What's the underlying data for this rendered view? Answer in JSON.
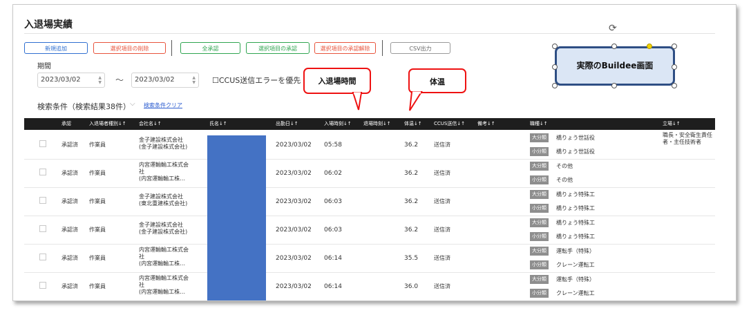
{
  "page": {
    "title": "入退場実績"
  },
  "toolbar": {
    "new_label": "新規追加",
    "delete_label": "選択項目の削除",
    "approve_all_label": "全承認",
    "approve_selected_label": "選択項目の承認",
    "unapprove_selected_label": "選択項目の承認解除",
    "csv_label": "CSV出力"
  },
  "filters": {
    "period_label": "期間",
    "date_from": "2023/03/02",
    "tilde": "～",
    "date_to": "2023/03/02",
    "ccus_priority_label": "☐CCUS送信エラーを優先",
    "search_conditions": "検索条件（検索結果38件）",
    "clear_label": "検索条件クリア"
  },
  "annotations": {
    "entry_time": "入退場時間",
    "temperature": "体温",
    "buildee": "実際のBuildee画面"
  },
  "colors": {
    "danger": "#e8533b",
    "success": "#2ea44f",
    "primary": "#2f6fd0",
    "table_header": "#1e1e1e",
    "name_mask": "#4472c4",
    "callout": "#ee1111"
  },
  "table": {
    "headers": {
      "approval": "承認",
      "entry_type": "入退場者種別↓↑",
      "company": "会社名↓↑",
      "name": "氏名↓↑",
      "work_date": "出勤日↓↑",
      "entry_time": "入場時刻↓↑",
      "exit_time": "退場時刻↓↑",
      "temperature": "体温↓↑",
      "ccus_status": "CCUS送信↓↑",
      "notes": "備考↓↑",
      "occupation": "職種↓↑",
      "position": "立場↓↑"
    },
    "badge_major": "大分類",
    "badge_minor": "小分類",
    "rows": [
      {
        "status": "承認済",
        "type": "作業員",
        "company_1": "金子建設株式会社",
        "company_2": "(金子建設株式会社)",
        "company_3": "",
        "date": "2023/03/02",
        "entry": "05:58",
        "temp": "36.2",
        "ccus": "送信済",
        "major": "橋りょう世話役",
        "minor": "橋りょう世話役",
        "position": "職長・安全衛生責任者・主任技術者"
      },
      {
        "status": "承認済",
        "type": "作業員",
        "company_1": "内宮運輸輸工株式会",
        "company_2": "社",
        "company_3": "(内宮運輸輸工株…",
        "date": "2023/03/02",
        "entry": "06:02",
        "temp": "36.2",
        "ccus": "送信済",
        "major": "その他",
        "minor": "その他",
        "position": ""
      },
      {
        "status": "承認済",
        "type": "作業員",
        "company_1": "金子建設株式会社",
        "company_2": "(東北重建株式会社)",
        "company_3": "",
        "date": "2023/03/02",
        "entry": "06:03",
        "temp": "36.2",
        "ccus": "送信済",
        "major": "橋りょう特殊工",
        "minor": "橋りょう特殊工",
        "position": ""
      },
      {
        "status": "承認済",
        "type": "作業員",
        "company_1": "金子建設株式会社",
        "company_2": "(金子建設株式会社)",
        "company_3": "",
        "date": "2023/03/02",
        "entry": "06:03",
        "temp": "36.2",
        "ccus": "送信済",
        "major": "橋りょう特殊工",
        "minor": "橋りょう特殊工",
        "position": ""
      },
      {
        "status": "承認済",
        "type": "作業員",
        "company_1": "内宮運輸輸工株式会",
        "company_2": "社",
        "company_3": "(内宮運輸輸工株…",
        "date": "2023/03/02",
        "entry": "06:14",
        "temp": "35.5",
        "ccus": "送信済",
        "major": "運転手（特殊）",
        "minor": "クレーン運転工",
        "position": ""
      },
      {
        "status": "承認済",
        "type": "作業員",
        "company_1": "内宮運輸輸工株式会",
        "company_2": "社",
        "company_3": "(内宮運輸輸工株…",
        "date": "2023/03/02",
        "entry": "06:14",
        "temp": "36.0",
        "ccus": "送信済",
        "major": "運転手（特殊）",
        "minor": "クレーン運転工",
        "position": ""
      }
    ]
  }
}
